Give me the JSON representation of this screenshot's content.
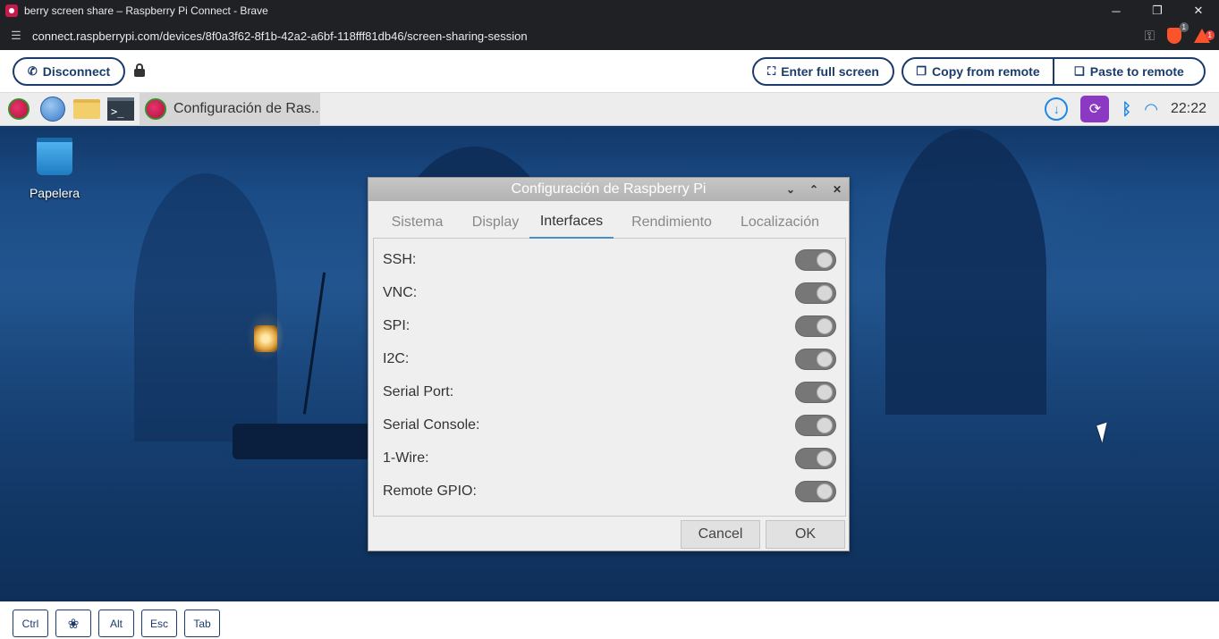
{
  "browser": {
    "tab_title": "berry screen share – Raspberry Pi Connect - Brave",
    "url": "connect.raspberrypi.com/devices/8f0a3f62-8f1b-42a2-a6bf-118fff81db46/screen-sharing-session",
    "shield_badge": "1",
    "rewards_badge": "1",
    "window_controls": {
      "minimize": "─",
      "maximize": "❐",
      "close": "✕"
    }
  },
  "connect_toolbar": {
    "disconnect_label": "Disconnect",
    "fullscreen_label": "Enter full screen",
    "copy_label": "Copy from remote",
    "paste_label": "Paste to remote",
    "accent_color": "#1b3c6b"
  },
  "pi_desktop": {
    "taskbar": {
      "active_window_label": "Configuración de Ras..",
      "time": "22:22",
      "terminal_glyph": ">_"
    },
    "desktop_icons": [
      {
        "label": "Papelera",
        "icon": "trash-icon"
      }
    ]
  },
  "dialog": {
    "title": "Configuración de Raspberry Pi",
    "tabs": [
      "Sistema",
      "Display",
      "Interfaces",
      "Rendimiento",
      "Localización"
    ],
    "active_tab": "Interfaces",
    "settings": [
      {
        "label": "SSH:",
        "enabled": true
      },
      {
        "label": "VNC:",
        "enabled": true
      },
      {
        "label": "SPI:",
        "enabled": true
      },
      {
        "label": "I2C:",
        "enabled": true
      },
      {
        "label": "Serial Port:",
        "enabled": true
      },
      {
        "label": "Serial Console:",
        "enabled": true
      },
      {
        "label": "1-Wire:",
        "enabled": true
      },
      {
        "label": "Remote GPIO:",
        "enabled": true
      }
    ],
    "cancel_label": "Cancel",
    "ok_label": "OK"
  },
  "keybar": {
    "keys": [
      "Ctrl",
      "Alt",
      "Esc",
      "Tab"
    ],
    "raspberry_key_icon": "raspberry-key-icon"
  }
}
